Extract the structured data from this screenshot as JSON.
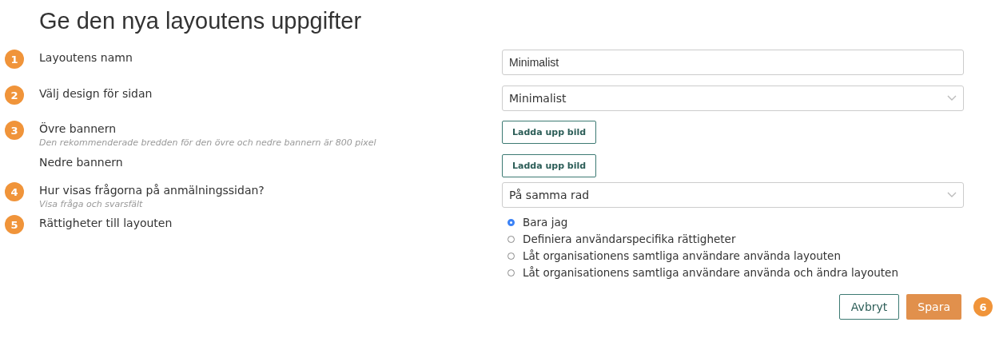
{
  "title": "Ge den nya layoutens uppgifter",
  "rows": [
    {
      "badge": "1",
      "label": "Layoutens namn",
      "kind": "text",
      "value": "Minimalist"
    },
    {
      "badge": "2",
      "label": "Välj design för sidan",
      "kind": "select",
      "value": "Minimalist"
    },
    {
      "badge": "3",
      "label": "Övre bannern",
      "hint": "Den rekommenderade bredden för den övre och nedre bannern är 800 pixel",
      "kind": "upload",
      "button": "Ladda upp bild"
    },
    {
      "label": "Nedre bannern",
      "kind": "upload",
      "button": "Ladda upp bild"
    },
    {
      "badge": "4",
      "label": "Hur visas frågorna på anmälningssidan?",
      "hint": "Visa fråga och svarsfält",
      "kind": "select",
      "value": "På samma rad"
    },
    {
      "badge": "5",
      "label": "Rättigheter till layouten",
      "kind": "radios",
      "options": [
        {
          "label": "Bara jag",
          "selected": true
        },
        {
          "label": "Definiera användarspecifika rättigheter",
          "selected": false
        },
        {
          "label": "Låt organisationens samtliga användare använda layouten",
          "selected": false
        },
        {
          "label": "Låt organisationens samtliga användare använda och ändra layouten",
          "selected": false
        }
      ]
    }
  ],
  "actions": {
    "cancel": "Avbryt",
    "save": "Spara",
    "badge": "6"
  }
}
